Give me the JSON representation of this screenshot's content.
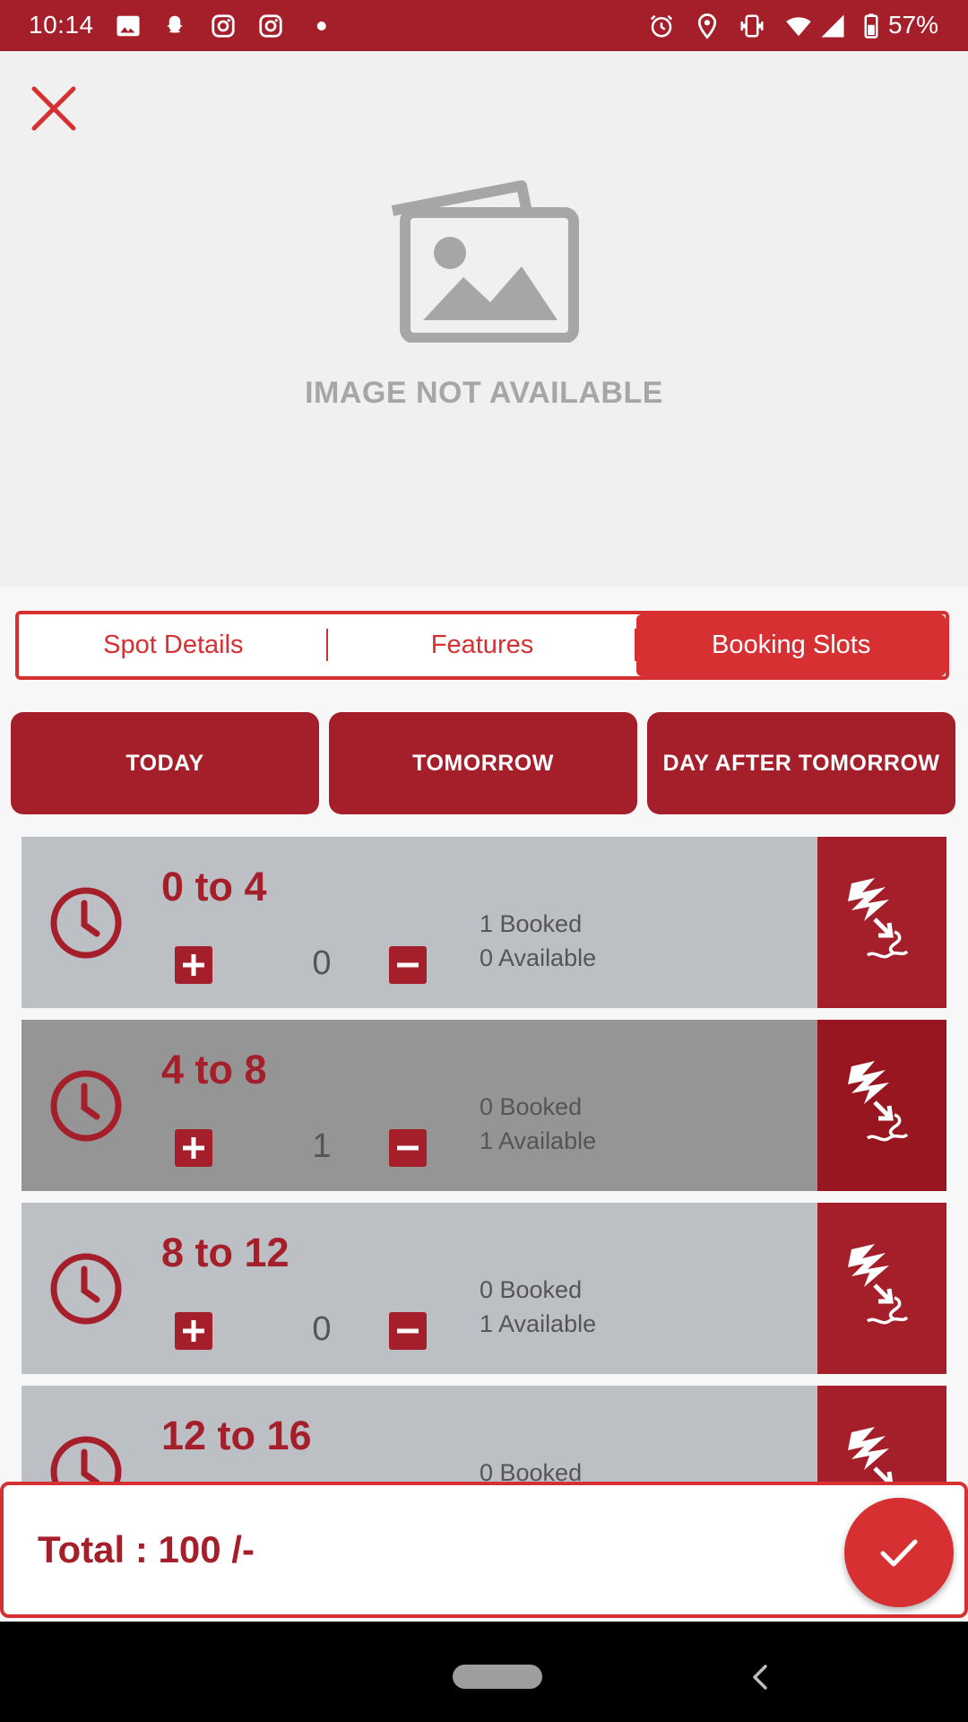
{
  "status_bar": {
    "time": "10:14",
    "battery": "57%",
    "icons": [
      "image-icon",
      "snapchat-icon",
      "instagram-icon",
      "instagram-icon",
      "dot-icon",
      "alarm-icon",
      "location-icon",
      "vibrate-icon",
      "wifi-icon",
      "signal-icon",
      "battery-icon"
    ]
  },
  "hero": {
    "placeholder_text": "IMAGE NOT AVAILABLE"
  },
  "tabs": [
    {
      "label": "Spot Details",
      "active": false
    },
    {
      "label": "Features",
      "active": false
    },
    {
      "label": "Booking Slots",
      "active": true
    }
  ],
  "days": [
    "TODAY",
    "TOMORROW",
    "DAY AFTER TOMORROW"
  ],
  "slots": [
    {
      "title": "0 to 4",
      "qty": "0",
      "booked": "1 Booked",
      "available": "0 Available",
      "selected": false
    },
    {
      "title": "4 to 8",
      "qty": "1",
      "booked": "0 Booked",
      "available": "1 Available",
      "selected": true
    },
    {
      "title": "8 to 12",
      "qty": "0",
      "booked": "0 Booked",
      "available": "1 Available",
      "selected": false
    },
    {
      "title": "12 to 16",
      "qty": "",
      "booked": "0 Booked",
      "available": "",
      "selected": false
    }
  ],
  "total": {
    "label": "Total :  100 /-"
  },
  "colors": {
    "primary": "#a51f2b",
    "accent": "#d63032",
    "slot_bg": "#bcc0c5",
    "slot_selected_bg": "#959595"
  }
}
